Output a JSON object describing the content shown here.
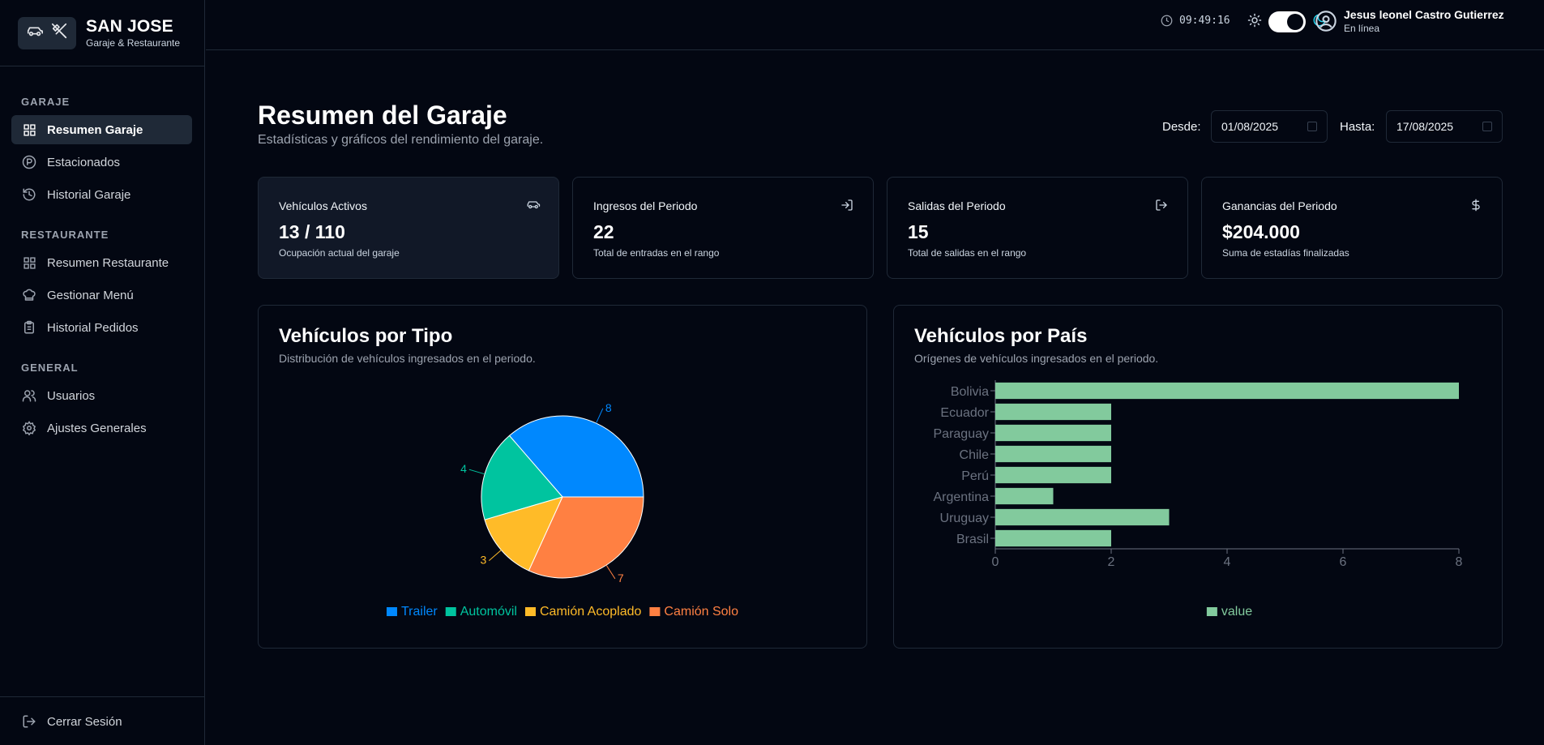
{
  "brand": {
    "name": "SAN JOSE",
    "subtitle": "Garaje & Restaurante"
  },
  "sidebar": {
    "sections": [
      {
        "label": "GARAJE",
        "items": [
          {
            "label": "Resumen Garaje",
            "icon": "grid-icon",
            "active": true
          },
          {
            "label": "Estacionados",
            "icon": "parking-icon"
          },
          {
            "label": "Historial Garaje",
            "icon": "history-icon"
          }
        ]
      },
      {
        "label": "RESTAURANTE",
        "items": [
          {
            "label": "Resumen Restaurante",
            "icon": "grid-icon"
          },
          {
            "label": "Gestionar Menú",
            "icon": "chef-hat-icon"
          },
          {
            "label": "Historial Pedidos",
            "icon": "clipboard-icon"
          }
        ]
      },
      {
        "label": "GENERAL",
        "items": [
          {
            "label": "Usuarios",
            "icon": "users-icon"
          },
          {
            "label": "Ajustes Generales",
            "icon": "gear-icon"
          }
        ]
      }
    ],
    "logout": "Cerrar Sesión"
  },
  "topbar": {
    "clock": "09:49:16",
    "theme": "dark",
    "user_name": "Jesus leonel Castro Gutierrez",
    "user_status": "En línea"
  },
  "page": {
    "title": "Resumen del Garaje",
    "subtitle": "Estadísticas y gráficos del rendimiento del garaje.",
    "from_label": "Desde:",
    "from_value": "01/08/2025",
    "to_label": "Hasta:",
    "to_value": "17/08/2025"
  },
  "cards": [
    {
      "title": "Vehículos Activos",
      "value": "13 / 110",
      "desc": "Ocupación actual del garaje",
      "icon": "car-icon"
    },
    {
      "title": "Ingresos del Periodo",
      "value": "22",
      "desc": "Total de entradas en el rango",
      "icon": "login-icon"
    },
    {
      "title": "Salidas del Periodo",
      "value": "15",
      "desc": "Total de salidas en el rango",
      "icon": "logout-icon"
    },
    {
      "title": "Ganancias del Periodo",
      "value": "$204.000",
      "desc": "Suma de estadías finalizadas",
      "icon": "dollar-icon"
    }
  ],
  "panels": {
    "tipo": {
      "title": "Vehículos por Tipo",
      "subtitle": "Distribución de vehículos ingresados en el periodo."
    },
    "pais": {
      "title": "Vehículos por País",
      "subtitle": "Orígenes de vehículos ingresados en el periodo."
    }
  },
  "chart_data": [
    {
      "type": "pie",
      "title": "Vehículos por Tipo",
      "series": [
        {
          "name": "Trailer",
          "value": 8,
          "color": "#0088fe"
        },
        {
          "name": "Automóvil",
          "value": 4,
          "color": "#00c49f"
        },
        {
          "name": "Camión Acoplado",
          "value": 3,
          "color": "#ffbb28"
        },
        {
          "name": "Camión Solo",
          "value": 7,
          "color": "#ff8042"
        }
      ],
      "legend": "bottom"
    },
    {
      "type": "bar",
      "orientation": "horizontal",
      "title": "Vehículos por País",
      "categories": [
        "Bolivia",
        "Ecuador",
        "Paraguay",
        "Chile",
        "Perú",
        "Argentina",
        "Uruguay",
        "Brasil"
      ],
      "series": [
        {
          "name": "value",
          "values": [
            8,
            2,
            2,
            2,
            2,
            1,
            3,
            2
          ],
          "color": "#82ca9d"
        }
      ],
      "xlim": [
        0,
        8
      ],
      "xticks": [
        0,
        2,
        4,
        6,
        8
      ],
      "legend": "bottom"
    }
  ]
}
